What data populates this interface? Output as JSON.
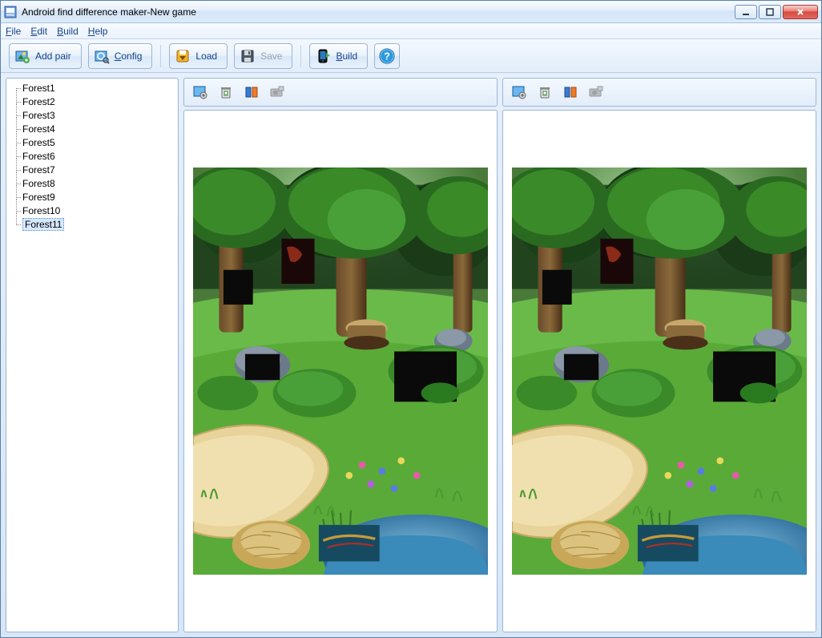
{
  "window": {
    "title": "Android find difference maker-New game"
  },
  "menu": {
    "file": "File",
    "edit": "Edit",
    "build": "Build",
    "help": "Help"
  },
  "toolbar": {
    "add_pair": "Add pair",
    "config": "Config",
    "load": "Load",
    "save": "Save",
    "build": "Build",
    "help_icon": "help-icon"
  },
  "sidebar": {
    "items": [
      "Forest1",
      "Forest2",
      "Forest3",
      "Forest4",
      "Forest5",
      "Forest6",
      "Forest7",
      "Forest8",
      "Forest9",
      "Forest10",
      "Forest11"
    ],
    "selected_index": 10
  },
  "pane_icons": {
    "image_settings": "image-settings-icon",
    "trash": "trash-icon",
    "compare": "compare-icon",
    "camera": "camera-icon"
  }
}
